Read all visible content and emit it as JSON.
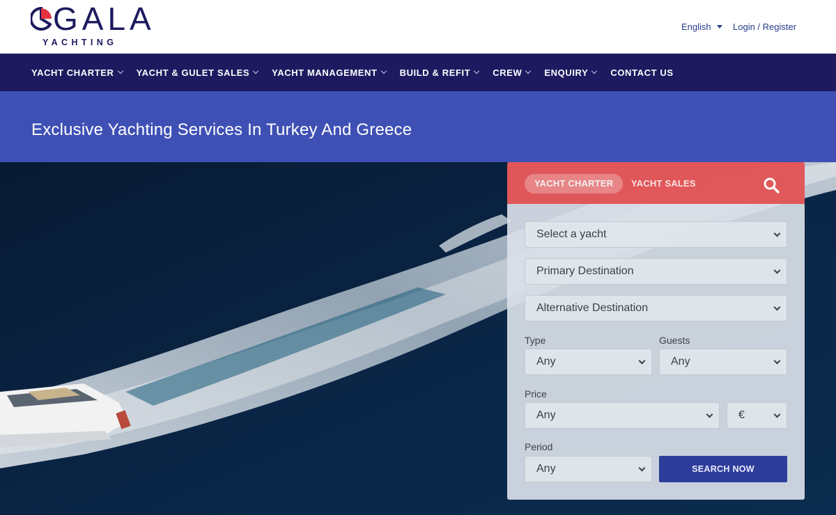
{
  "header": {
    "logo_text": "GALA",
    "logo_subtext": "YACHTING",
    "language": "English",
    "login_label": "Login / Register"
  },
  "nav": {
    "items": [
      {
        "label": "YACHT CHARTER",
        "has_dropdown": true
      },
      {
        "label": "YACHT & GULET SALES",
        "has_dropdown": true
      },
      {
        "label": "YACHT MANAGEMENT",
        "has_dropdown": true
      },
      {
        "label": "BUILD & REFIT",
        "has_dropdown": true
      },
      {
        "label": "CREW",
        "has_dropdown": true
      },
      {
        "label": "ENQUIRY",
        "has_dropdown": true
      },
      {
        "label": "CONTACT US",
        "has_dropdown": false
      }
    ]
  },
  "banner": {
    "title": "Exclusive Yachting Services In Turkey And Greece"
  },
  "search_panel": {
    "tabs": [
      {
        "label": "YACHT CHARTER",
        "active": true
      },
      {
        "label": "YACHT SALES",
        "active": false
      }
    ],
    "yacht_select": "Select a yacht",
    "primary_destination": "Primary Destination",
    "alternative_destination": "Alternative Destination",
    "type_label": "Type",
    "type_value": "Any",
    "guests_label": "Guests",
    "guests_value": "Any",
    "price_label": "Price",
    "price_value": "Any",
    "currency_value": "€",
    "period_label": "Period",
    "period_value": "Any",
    "search_button": "SEARCH NOW"
  },
  "colors": {
    "brand_navy": "#1e1a60",
    "banner_blue": "#3f50b5",
    "panel_red": "#e25052",
    "button_blue": "#2e3d9a"
  }
}
